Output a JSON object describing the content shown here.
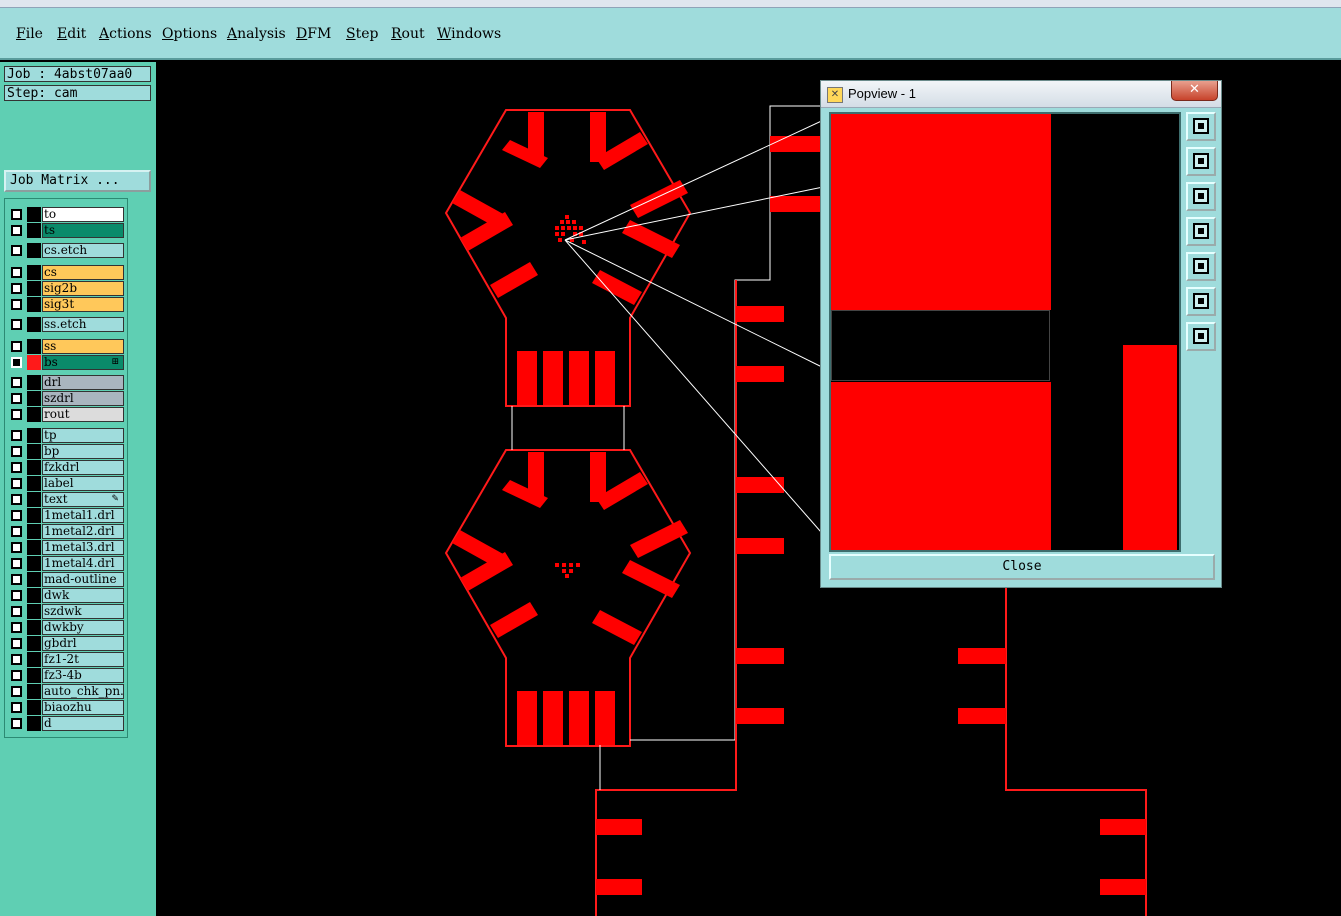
{
  "menu": {
    "items": [
      "File",
      "Edit",
      "Actions",
      "Options",
      "Analysis",
      "DFM",
      "Step",
      "Rout",
      "Windows"
    ]
  },
  "info": {
    "job": "Job : 4abst07aa0",
    "step": "Step: cam",
    "job_matrix": "Job Matrix ..."
  },
  "layers": [
    {
      "name": "to",
      "color": "#ffffff",
      "checkbox": "white",
      "swatch": "black"
    },
    {
      "name": "ts",
      "color": "#0a8a6a",
      "checkbox": "white",
      "swatch": "black"
    },
    {
      "name": "cs.etch",
      "color": "#9fdcdc",
      "checkbox": "white",
      "swatch": "black"
    },
    {
      "name": "cs",
      "color": "#ffc85a",
      "checkbox": "white",
      "swatch": "black"
    },
    {
      "name": "sig2b",
      "color": "#ffc85a",
      "checkbox": "white",
      "swatch": "black"
    },
    {
      "name": "sig3t",
      "color": "#ffc85a",
      "checkbox": "white",
      "swatch": "black"
    },
    {
      "name": "ss.etch",
      "color": "#9fdcdc",
      "checkbox": "white",
      "swatch": "black"
    },
    {
      "name": "ss",
      "color": "#ffc85a",
      "checkbox": "white",
      "swatch": "black"
    },
    {
      "name": "bs",
      "color": "#0a8a6a",
      "checkbox": "dark",
      "swatch": "red",
      "mark": "⊞"
    },
    {
      "name": "drl",
      "color": "#a9b5bf",
      "checkbox": "white",
      "swatch": "black"
    },
    {
      "name": "szdrl",
      "color": "#a9b5bf",
      "checkbox": "white",
      "swatch": "black"
    },
    {
      "name": "rout",
      "color": "#dcdcdc",
      "checkbox": "white",
      "swatch": "black"
    },
    {
      "name": "tp",
      "color": "#9fdcdc",
      "checkbox": "white",
      "swatch": "black"
    },
    {
      "name": "bp",
      "color": "#9fdcdc",
      "checkbox": "white",
      "swatch": "black"
    },
    {
      "name": "fzkdrl",
      "color": "#9fdcdc",
      "checkbox": "white",
      "swatch": "black"
    },
    {
      "name": "label",
      "color": "#9fdcdc",
      "checkbox": "white",
      "swatch": "black"
    },
    {
      "name": "text",
      "color": "#9fdcdc",
      "checkbox": "white",
      "swatch": "black",
      "mark": "✎"
    },
    {
      "name": "1metal1.drl",
      "color": "#9fdcdc",
      "checkbox": "white",
      "swatch": "black"
    },
    {
      "name": "1metal2.drl",
      "color": "#9fdcdc",
      "checkbox": "white",
      "swatch": "black"
    },
    {
      "name": "1metal3.drl",
      "color": "#9fdcdc",
      "checkbox": "white",
      "swatch": "black"
    },
    {
      "name": "1metal4.drl",
      "color": "#9fdcdc",
      "checkbox": "white",
      "swatch": "black"
    },
    {
      "name": "mad-outline",
      "color": "#9fdcdc",
      "checkbox": "white",
      "swatch": "black"
    },
    {
      "name": "dwk",
      "color": "#9fdcdc",
      "checkbox": "white",
      "swatch": "black"
    },
    {
      "name": "szdwk",
      "color": "#9fdcdc",
      "checkbox": "white",
      "swatch": "black"
    },
    {
      "name": "dwkby",
      "color": "#9fdcdc",
      "checkbox": "white",
      "swatch": "black"
    },
    {
      "name": "gbdrl",
      "color": "#9fdcdc",
      "checkbox": "white",
      "swatch": "black"
    },
    {
      "name": "fz1-2t",
      "color": "#9fdcdc",
      "checkbox": "white",
      "swatch": "black"
    },
    {
      "name": "fz3-4b",
      "color": "#9fdcdc",
      "checkbox": "white",
      "swatch": "black"
    },
    {
      "name": "auto_chk_pn.",
      "color": "#9fdcdc",
      "checkbox": "white",
      "swatch": "black"
    },
    {
      "name": "biaozhu",
      "color": "#9fdcdc",
      "checkbox": "white",
      "swatch": "black"
    },
    {
      "name": "d",
      "color": "#9fdcdc",
      "checkbox": "white",
      "swatch": "black"
    }
  ],
  "popview": {
    "title": "Popview - 1",
    "close_x": "✕",
    "close_button": "Close",
    "tools": [
      "zoom-home-icon",
      "zoom-up-icon",
      "zoom-down-icon",
      "pan-left-icon",
      "pan-right-icon",
      "zoom-fit-icon",
      "zoom-extent-icon"
    ]
  },
  "colors": {
    "copper": "#ff0000",
    "outline": "#ffffff",
    "panel": "#9fdcdc",
    "panel_dark": "#5fcfb3"
  }
}
